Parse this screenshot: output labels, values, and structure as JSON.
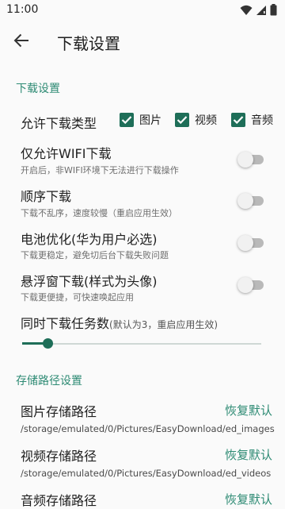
{
  "status_bar": {
    "time": "11:00",
    "icons": [
      "wifi-icon",
      "cellular-signal-icon",
      "battery-icon"
    ]
  },
  "app_bar": {
    "title": "下载设置",
    "back_icon": "arrow-back-icon"
  },
  "download_section": {
    "header": "下载设置",
    "allowed_types": {
      "label": "允许下载类型",
      "options": [
        {
          "label": "图片",
          "checked": true
        },
        {
          "label": "视频",
          "checked": true
        },
        {
          "label": "音频",
          "checked": true
        }
      ]
    },
    "toggles": [
      {
        "title": "仅允许WIFI下载",
        "subtitle": "开启后，非WIFI环境下无法进行下载操作",
        "on": false
      },
      {
        "title": "顺序下载",
        "subtitle": "下载不乱序，速度较慢（重启应用生效）",
        "on": false
      },
      {
        "title": "电池优化(华为用户必选)",
        "subtitle": "下载更稳定，避免切后台下载失败问题",
        "on": false
      },
      {
        "title": "悬浮窗下载(样式为头像)",
        "subtitle": "下载更便捷，可快速唤起应用",
        "on": false
      }
    ],
    "concurrent": {
      "title": "同时下载任务数",
      "hint": "(默认为3，重启应用生效)",
      "value": 3,
      "min": 1,
      "max": 20
    }
  },
  "storage_section": {
    "header": "存储路径设置",
    "paths": [
      {
        "title": "图片存储路径",
        "reset_label": "恢复默认",
        "value": "/storage/emulated/0/Pictures/EasyDownload/ed_images"
      },
      {
        "title": "视频存储路径",
        "reset_label": "恢复默认",
        "value": "/storage/emulated/0/Pictures/EasyDownload/ed_videos"
      },
      {
        "title": "音频存储路径",
        "reset_label": "恢复默认",
        "value": ""
      }
    ]
  },
  "colors": {
    "accent": "#1e6e58",
    "section_header": "#2e8b74",
    "background": "#fafafa",
    "switch_track_off": "#b9b9b9"
  }
}
